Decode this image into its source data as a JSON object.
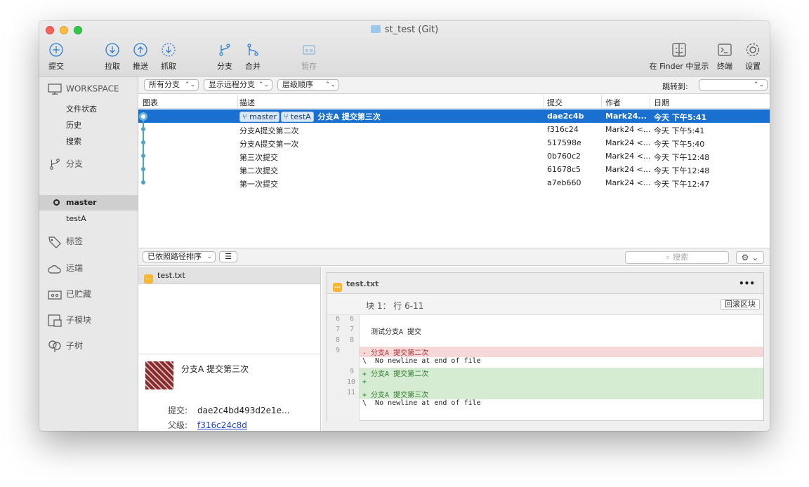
{
  "window": {
    "title": "st_test (Git)"
  },
  "toolbar": {
    "commit": "提交",
    "pull": "拉取",
    "push": "推送",
    "fetch": "抓取",
    "branch": "分支",
    "merge": "合并",
    "stash": "暂存",
    "finder": "在 Finder 中显示",
    "terminal": "终端",
    "settings": "设置"
  },
  "sidebar": {
    "workspace": "WORKSPACE",
    "workspace_items": [
      "文件状态",
      "历史",
      "搜索"
    ],
    "branches": "分支",
    "branch_items": [
      "master",
      "testA"
    ],
    "tags": "标签",
    "remotes": "远端",
    "stashes": "已贮藏",
    "submodules": "子模块",
    "subtrees": "子树"
  },
  "filters": {
    "branches": "所有分支",
    "remote": "显示远程分支",
    "order": "层级顺序",
    "jump_label": "跳转到:"
  },
  "table": {
    "headers": [
      "图表",
      "描述",
      "提交",
      "作者",
      "日期"
    ],
    "rows": [
      {
        "tags": [
          "master",
          "testA"
        ],
        "desc": "分支A 提交第三次",
        "hash": "dae2c4b",
        "author": "Mark24...",
        "date": "今天 下午5:41"
      },
      {
        "desc": "分支A提交第二次",
        "hash": "f316c24",
        "author": "Mark24 <...",
        "date": "今天 下午5:41"
      },
      {
        "desc": "分支A提交第一次",
        "hash": "517598e",
        "author": "Mark24 <...",
        "date": "今天 下午5:40"
      },
      {
        "desc": "第三次提交",
        "hash": "0b760c2",
        "author": "Mark24 <...",
        "date": "今天 下午12:48"
      },
      {
        "desc": "第二次提交",
        "hash": "61678c5",
        "author": "Mark24 <...",
        "date": "今天 下午12:48"
      },
      {
        "desc": "第一次提交",
        "hash": "a7eb660",
        "author": "Mark24 <...",
        "date": "今天 下午12:47"
      }
    ]
  },
  "lower": {
    "sort": "已依照路径排序",
    "search_placeholder": "搜索"
  },
  "files": {
    "name": "test.txt"
  },
  "detail": {
    "message": "分支A 提交第三次",
    "commit_label": "提交:",
    "commit_value": "dae2c4bd493d2e1e...",
    "parent_label": "父级:",
    "parent_value": "f316c24c8d"
  },
  "diff": {
    "file": "test.txt",
    "more": "•••",
    "hunk": "块 1： 行 6-11",
    "rollback": "回滚区块",
    "lines": [
      {
        "n1": "6",
        "n2": "6",
        "text": "",
        "kind": "ctx"
      },
      {
        "n1": "7",
        "n2": "7",
        "text": "测试分支A 提交",
        "kind": "ctx"
      },
      {
        "n1": "8",
        "n2": "8",
        "text": "",
        "kind": "ctx"
      },
      {
        "n1": "9",
        "n2": "",
        "text": "- 分支A 提交第二次",
        "kind": "del"
      },
      {
        "n1": "",
        "n2": "",
        "text": "\\  No newline at end of file",
        "kind": "ctx"
      },
      {
        "n1": "",
        "n2": "9",
        "text": "+ 分支A 提交第二次",
        "kind": "add"
      },
      {
        "n1": "",
        "n2": "10",
        "text": "+",
        "kind": "add"
      },
      {
        "n1": "",
        "n2": "11",
        "text": "+ 分支A 提交第三次",
        "kind": "add"
      },
      {
        "n1": "",
        "n2": "",
        "text": "\\  No newline at end of file",
        "kind": "ctx"
      }
    ]
  }
}
